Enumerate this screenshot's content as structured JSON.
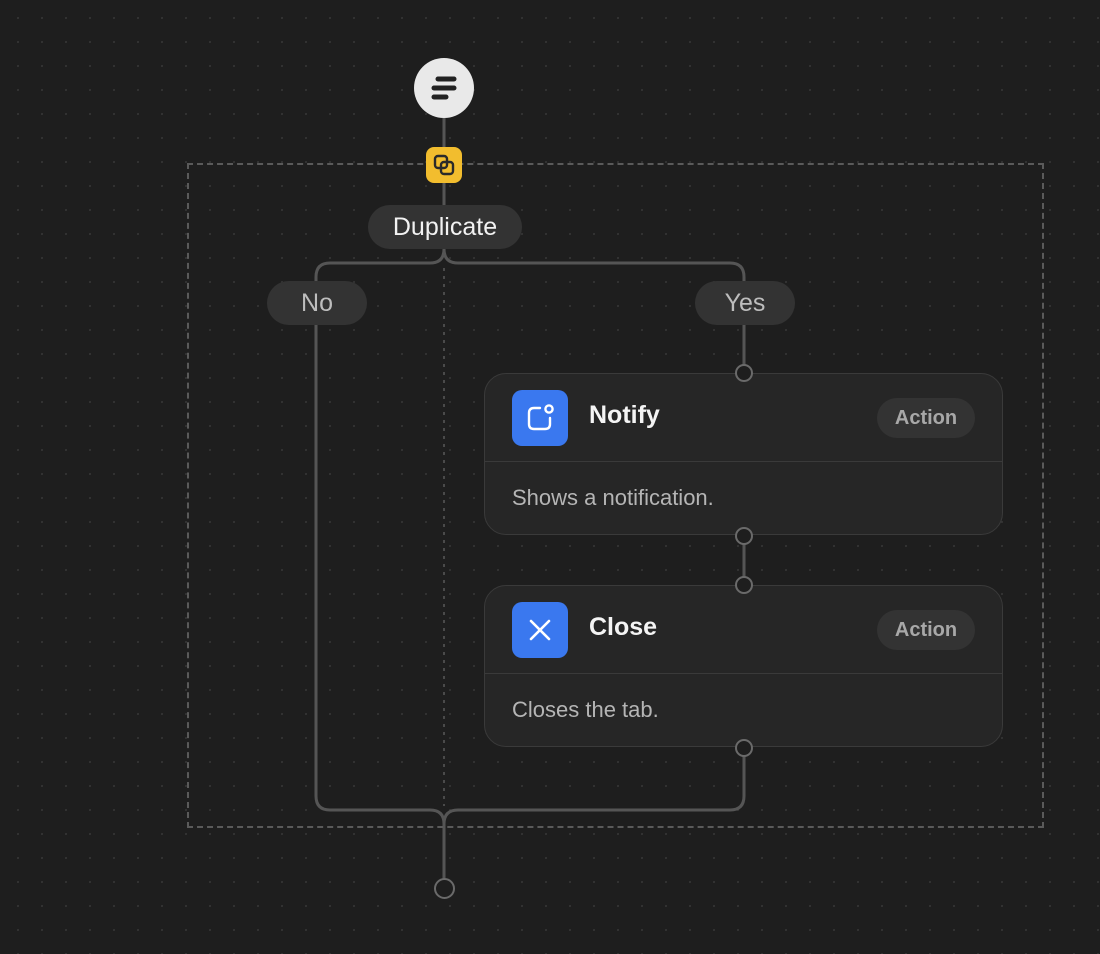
{
  "flow": {
    "trigger": {
      "icon": "flow-trigger-icon"
    },
    "condition": {
      "icon": "duplicate-icon",
      "label": "Duplicate",
      "branch_no": "No",
      "branch_yes": "Yes"
    },
    "steps": [
      {
        "title": "Notify",
        "badge": "Action",
        "description": "Shows a notification.",
        "icon": "notification-icon"
      },
      {
        "title": "Close",
        "badge": "Action",
        "description": "Closes the tab.",
        "icon": "close-icon"
      }
    ]
  },
  "colors": {
    "background": "#1e1e1e",
    "action_blue": "#3a78ef",
    "condition_yellow": "#f2bd2e",
    "trigger_fill": "#e9e9e9",
    "wire": "#555555"
  }
}
